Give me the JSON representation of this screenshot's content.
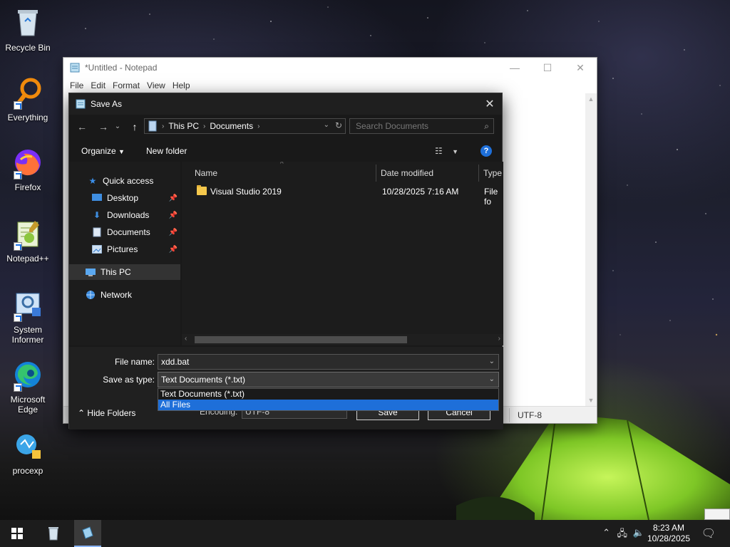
{
  "desktop": {
    "icons": [
      {
        "label": "Recycle Bin",
        "icon": "recycle-bin-icon"
      },
      {
        "label": "Everything",
        "icon": "everything-search-icon"
      },
      {
        "label": "Firefox",
        "icon": "firefox-icon"
      },
      {
        "label": "Notepad++",
        "icon": "notepad-plus-plus-icon"
      },
      {
        "label": "System Informer",
        "icon": "system-informer-icon"
      },
      {
        "label": "Microsoft Edge",
        "icon": "edge-icon"
      },
      {
        "label": "procexp",
        "icon": "procexp-icon"
      }
    ]
  },
  "notepad": {
    "title": "*Untitled - Notepad",
    "menu": [
      "File",
      "Edit",
      "Format",
      "View",
      "Help"
    ],
    "window_buttons": {
      "minimize": "—",
      "maximize": "☐",
      "close": "✕"
    },
    "status_encoding": "UTF-8"
  },
  "save_dialog": {
    "title": "Save As",
    "close_glyph": "✕",
    "breadcrumb": [
      "This PC",
      "Documents"
    ],
    "search_placeholder": "Search Documents",
    "toolbar": {
      "organize": "Organize",
      "new_folder": "New folder",
      "help": "?"
    },
    "nav_pane": {
      "quick_access": "Quick access",
      "items": [
        {
          "label": "Desktop",
          "pinned": true
        },
        {
          "label": "Downloads",
          "pinned": true
        },
        {
          "label": "Documents",
          "pinned": true
        },
        {
          "label": "Pictures",
          "pinned": true
        }
      ],
      "this_pc": "This PC",
      "network": "Network"
    },
    "columns": {
      "name": "Name",
      "date_modified": "Date modified",
      "type": "Type"
    },
    "files": [
      {
        "name": "Visual Studio 2019",
        "date": "10/28/2025 7:16 AM",
        "type": "File fo"
      }
    ],
    "file_name_label": "File name:",
    "file_name_value": "xdd.bat",
    "save_as_type_label": "Save as type:",
    "save_as_type_value": "Text Documents (*.txt)",
    "type_options": [
      "Text Documents (*.txt)",
      "All Files"
    ],
    "type_options_highlighted": "All Files",
    "hide_folders": "Hide Folders",
    "encoding_label": "Encoding:",
    "encoding_value": "UTF-8",
    "save_button": "Save",
    "cancel_button": "Cancel"
  },
  "taskbar": {
    "clock_time": "8:23 AM",
    "clock_date": "10/28/2025"
  },
  "colors": {
    "accent": "#1e6fd9",
    "dialog_bg": "#191919",
    "tent_glow": "#9be23a"
  }
}
